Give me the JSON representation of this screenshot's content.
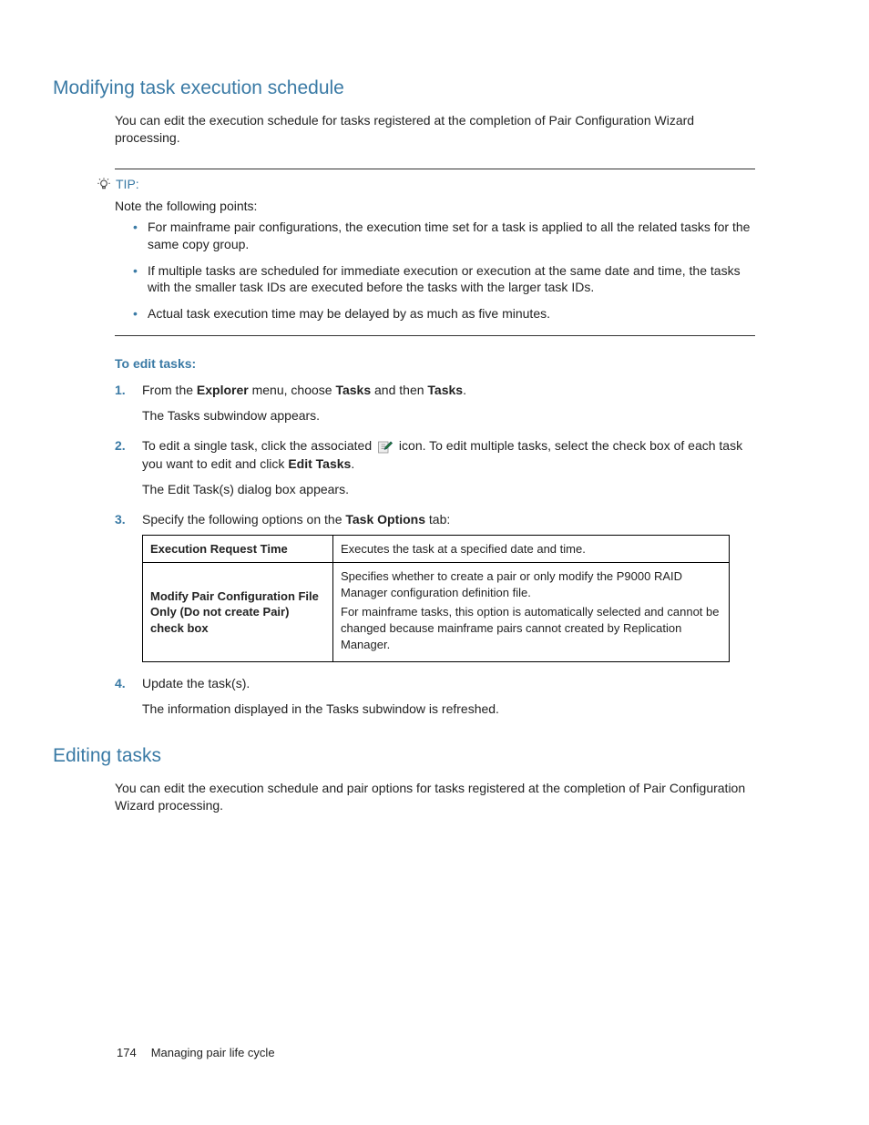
{
  "section1": {
    "heading": "Modifying task execution schedule",
    "intro": "You can edit the execution schedule for tasks registered at the completion of Pair Configuration Wizard processing."
  },
  "tip": {
    "label": "TIP:",
    "intro": "Note the following points:",
    "bullets": [
      "For mainframe pair configurations, the execution time set for a task is applied to all the related tasks for the same copy group.",
      "If multiple tasks are scheduled for immediate execution or execution at the same date and time, the tasks with the smaller task IDs are executed before the tasks with the larger task IDs.",
      "Actual task execution time may be delayed by as much as five minutes."
    ]
  },
  "steps": {
    "heading": "To edit tasks:",
    "s1a": "From the ",
    "s1b": "Explorer",
    "s1c": " menu, choose ",
    "s1d": "Tasks",
    "s1e": " and then ",
    "s1f": "Tasks",
    "s1g": ".",
    "s1sub": "The Tasks subwindow appears.",
    "s2a": "To edit a single task, click the associated ",
    "s2b": " icon. To edit multiple tasks, select the check box of each task you want to edit and click ",
    "s2c": "Edit Tasks",
    "s2d": ".",
    "s2sub": "The Edit Task(s) dialog box appears.",
    "s3a": "Specify the following options on the ",
    "s3b": "Task Options",
    "s3c": " tab:",
    "s4a": "Update the task(s).",
    "s4sub": "The information displayed in the Tasks subwindow is refreshed."
  },
  "table": {
    "r1k": "Execution Request Time",
    "r1v": "Executes the task at a specified date and time.",
    "r2k": "Modify Pair Configuration File Only (Do not create Pair) check box",
    "r2v1": "Specifies whether to create a pair or only modify the P9000 RAID Manager configuration definition file.",
    "r2v2": "For mainframe tasks, this option is automatically selected and cannot be changed because mainframe pairs cannot created by Replication Manager."
  },
  "section2": {
    "heading": "Editing tasks",
    "intro": "You can edit the execution schedule and pair options for tasks registered at the completion of Pair Configuration Wizard processing."
  },
  "footer": {
    "page": "174",
    "title": "Managing pair life cycle"
  }
}
